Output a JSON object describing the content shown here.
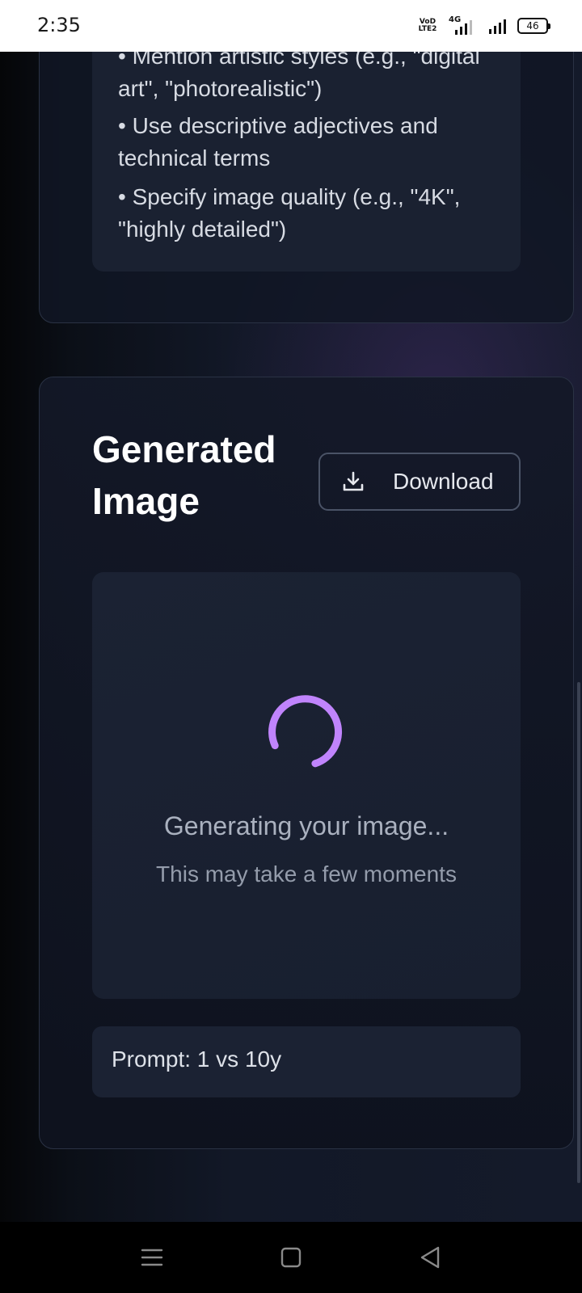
{
  "status_bar": {
    "time": "2:35",
    "volte_label": "VoD LTE2",
    "network_label": "4G",
    "battery": "46"
  },
  "tips": [
    "• Mention artistic styles (e.g., \"digital art\", \"photorealistic\")",
    "• Use descriptive adjectives and technical terms",
    "• Specify image quality (e.g., \"4K\", \"highly detailed\")"
  ],
  "generated": {
    "title": "Generated Image",
    "download_label": "Download",
    "loading_text": "Generating your image...",
    "loading_subtext": "This may take a few moments",
    "prompt": "Prompt: 1 vs 10y"
  },
  "colors": {
    "spinner": "#c084fc",
    "background": "#121827"
  },
  "icons": {
    "download": "download-icon",
    "spinner": "loading-spinner",
    "nav_menu": "menu-icon",
    "nav_home": "home-square-icon",
    "nav_back": "back-triangle-icon"
  }
}
